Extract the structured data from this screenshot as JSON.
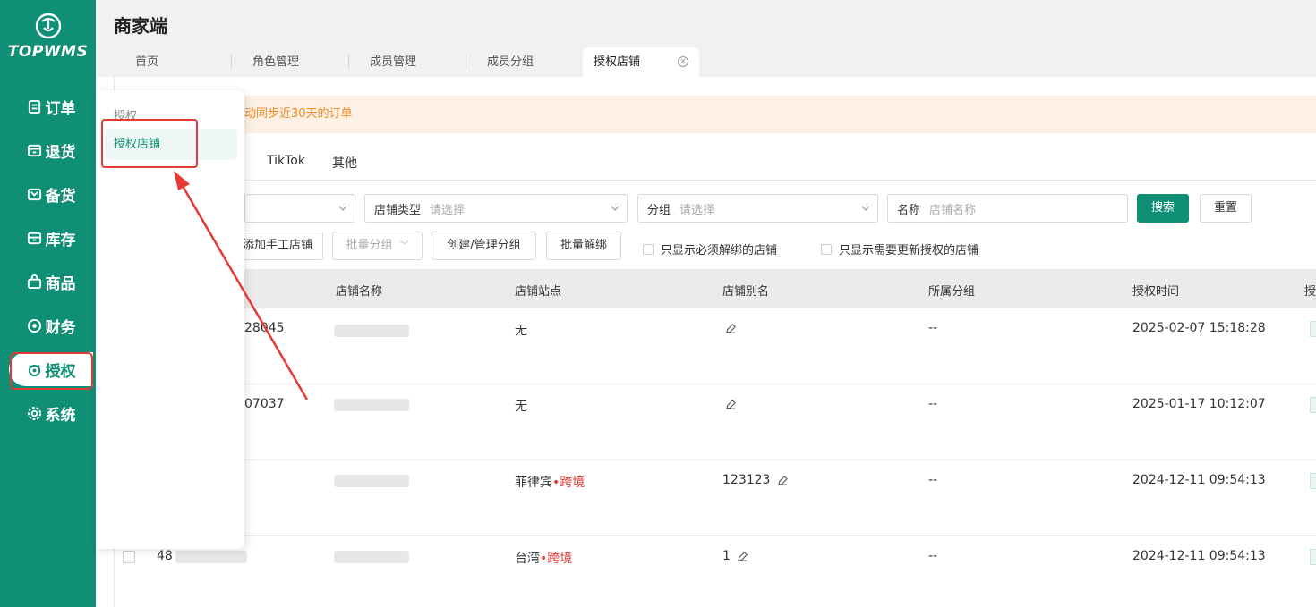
{
  "brand": {
    "name": "TOPWMS"
  },
  "sidebar": {
    "items": [
      {
        "label": "订单",
        "icon": "order-icon"
      },
      {
        "label": "退货",
        "icon": "return-icon"
      },
      {
        "label": "备货",
        "icon": "stock-prep-icon"
      },
      {
        "label": "库存",
        "icon": "inventory-icon"
      },
      {
        "label": "商品",
        "icon": "product-icon"
      },
      {
        "label": "财务",
        "icon": "finance-icon"
      },
      {
        "label": "授权",
        "icon": "authorize-icon",
        "active": true
      },
      {
        "label": "系统",
        "icon": "gear-icon"
      }
    ]
  },
  "header": {
    "title": "商家端",
    "tabs": [
      {
        "label": "首页"
      },
      {
        "label": "角色管理"
      },
      {
        "label": "成员管理"
      },
      {
        "label": "成员分组"
      },
      {
        "label": "授权店铺",
        "active": true
      }
    ]
  },
  "submenu": {
    "group_label": "授权",
    "item_label": "授权店铺"
  },
  "notice": {
    "text": "动同步近30天的订单"
  },
  "platform_tabs": [
    "TikTok",
    "其他"
  ],
  "filters": {
    "store_type": {
      "label": "店铺类型",
      "placeholder": "请选择"
    },
    "group": {
      "label": "分组",
      "placeholder": "请选择"
    },
    "name": {
      "label": "名称",
      "placeholder": "店铺名称"
    },
    "search_btn": "搜索",
    "reset_btn": "重置"
  },
  "actions": {
    "add_manual": "添加手工店铺",
    "batch_group": "批量分组",
    "create_group": "创建/管理分组",
    "batch_unbind": "批量解绑",
    "only_must_unbind": "只显示必须解绑的店铺",
    "only_need_update": "只显示需要更新授权的店铺"
  },
  "table": {
    "columns": [
      "店铺名称",
      "店铺站点",
      "店铺别名",
      "所属分组",
      "授权时间"
    ],
    "rows": [
      {
        "id_fragment": "28045",
        "site": "无",
        "site_tag": "",
        "alias": "",
        "group": "--",
        "time": "2025-02-07 15:18:28"
      },
      {
        "id_fragment": "07037",
        "site": "无",
        "site_tag": "",
        "alias": "",
        "group": "--",
        "time": "2025-01-17 10:12:07"
      },
      {
        "id_fragment": "",
        "site": "菲律宾",
        "site_tag": "跨境",
        "alias": "123123",
        "group": "--",
        "time": "2024-12-11 09:54:13"
      },
      {
        "id_fragment": "48",
        "site": "台湾",
        "site_tag": "跨境",
        "alias": "1",
        "group": "--",
        "time": "2024-12-11 09:54:13"
      }
    ]
  },
  "colors": {
    "brand": "#0e8f76",
    "highlight": "#e53935",
    "notice_text": "#f08a24"
  }
}
